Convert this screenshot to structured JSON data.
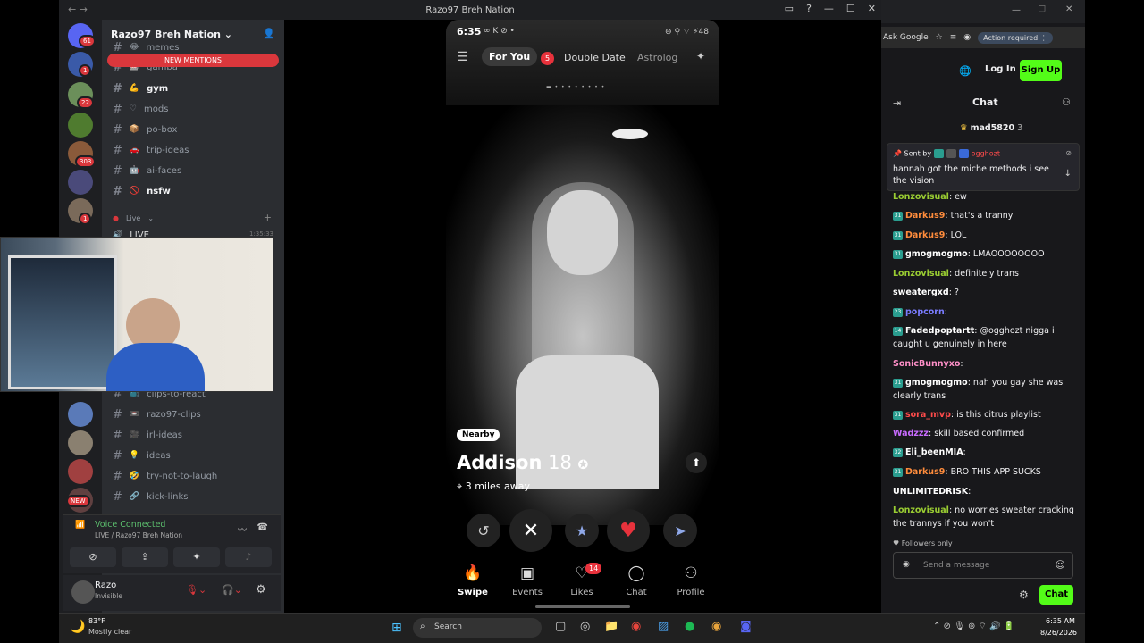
{
  "discord": {
    "window_title": "Razo97 Breh Nation",
    "server_name": "Razo97 Breh Nation",
    "new_mentions": "NEW MENTIONS",
    "channels": [
      {
        "name": "memes",
        "bold": false
      },
      {
        "name": "gamba",
        "bold": false
      },
      {
        "name": "gym",
        "bold": true
      },
      {
        "name": "mods",
        "bold": false
      },
      {
        "name": "po-box",
        "bold": false
      },
      {
        "name": "trip-ideas",
        "bold": false
      },
      {
        "name": "ai-faces",
        "bold": false
      },
      {
        "name": "nsfw",
        "bold": true
      }
    ],
    "channels_lower": [
      {
        "name": "clips-to-react"
      },
      {
        "name": "razo97-clips"
      },
      {
        "name": "irl-ideas"
      },
      {
        "name": "ideas"
      },
      {
        "name": "try-not-to-laugh"
      },
      {
        "name": "kick-links"
      }
    ],
    "category_live": "Live",
    "live_channel": "LIVE",
    "live_time": "1:35:33",
    "server_badges": [
      "61",
      "1",
      "22",
      "303",
      "1",
      "1",
      "NEW"
    ],
    "voice": {
      "status": "Voice Connected",
      "channel": "LIVE / Razo97 Breh Nation"
    },
    "user": {
      "name": "Razo",
      "status": "Invisible"
    }
  },
  "phone": {
    "time": "6:35",
    "battle": "48",
    "tabs_top": [
      "For You",
      "Double Date",
      "Astrolog"
    ],
    "double_date_badge": "5",
    "badge_nearby": "Nearby",
    "profile_name": "Addison",
    "profile_age": "18",
    "distance": "3 miles away",
    "bottom_tabs": [
      "Swipe",
      "Events",
      "Likes",
      "Chat",
      "Profile"
    ],
    "likes_badge": "14"
  },
  "browser": {
    "ask_google": "Ask Google",
    "action_required": "Action required",
    "login": "Log In",
    "signup": "Sign Up",
    "chat_header": "Chat",
    "top_gifter": "mad5820",
    "top_gifter_count": "3",
    "pinned_by_label": "Sent by",
    "pinned_by_user": "ogghozt",
    "pinned_text": "hannah got the miche methods i see the vision",
    "messages": [
      {
        "user": "Lonzovisual",
        "text": "ew",
        "color": "#9acd32",
        "tag": ""
      },
      {
        "user": "Darkus9",
        "text": "that's a tranny",
        "color": "#ff8c3c",
        "tag": "31"
      },
      {
        "user": "Darkus9",
        "text": "LOL",
        "color": "#ff8c3c",
        "tag": "31"
      },
      {
        "user": "gmogmogmo",
        "text": "LMAOOOOOOOO",
        "color": "#ffffff",
        "tag": "31"
      },
      {
        "user": "Lonzovisual",
        "text": "definitely trans",
        "color": "#9acd32",
        "tag": ""
      },
      {
        "user": "sweatergxd",
        "text": "?",
        "color": "#ffffff",
        "tag": ""
      },
      {
        "user": "popcorn",
        "text": "",
        "color": "#7a7cff",
        "tag": "23"
      },
      {
        "user": "Fadedpoptartt",
        "text": "@ogghozt nigga i caught u genuinely in here",
        "color": "#ffffff",
        "tag": "14"
      },
      {
        "user": "SonicBunnyxo",
        "text": "",
        "color": "#ff8fc8",
        "tag": ""
      },
      {
        "user": "gmogmogmo",
        "text": "nah you gay she was clearly trans",
        "color": "#ffffff",
        "tag": "31"
      },
      {
        "user": "sora_mvp",
        "text": "is this citrus playlist",
        "color": "#ff4b4b",
        "tag": "31"
      },
      {
        "user": "Wadzzz",
        "text": "skill based confirmed",
        "color": "#c86bff",
        "tag": ""
      },
      {
        "user": "Eli_beenMIA",
        "text": "",
        "color": "#ffffff",
        "tag": "32"
      },
      {
        "user": "Darkus9",
        "text": "BRO THIS APP SUCKS",
        "color": "#ff8c3c",
        "tag": "31"
      },
      {
        "user": "UNLIMITEDRISK",
        "text": "",
        "color": "#ffffff",
        "tag": ""
      },
      {
        "user": "Lonzovisual",
        "text": "no worries sweater cracking the trannys if you won't",
        "color": "#9acd32",
        "tag": ""
      }
    ],
    "followers_only": "Followers only",
    "send_placeholder": "Send a message",
    "chat_button": "Chat"
  },
  "taskbar": {
    "temp": "83°F",
    "weather": "Mostly clear",
    "search": "Search",
    "time": "6:35 AM",
    "date": "8/26/2026"
  }
}
